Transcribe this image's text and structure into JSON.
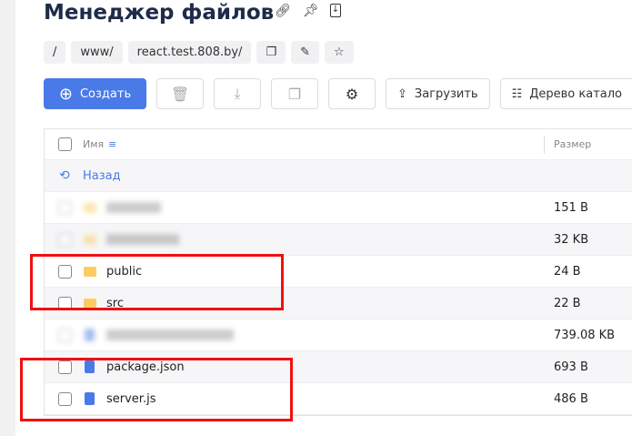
{
  "header": {
    "title": "Менеджер файлов",
    "icons": [
      "link-icon",
      "pin-icon",
      "download-file-icon"
    ]
  },
  "breadcrumbs": [
    "/",
    "www/",
    "react.test.808.by/"
  ],
  "breadcrumb_actions": [
    "copy-icon",
    "pencil-icon",
    "folder-star-icon"
  ],
  "toolbar": {
    "create_label": "Создать",
    "upload_label": "Загрузить",
    "tree_label": "Дерево катало"
  },
  "table": {
    "col_name": "Имя",
    "col_size": "Размер",
    "back_label": "Назад",
    "rows": [
      {
        "name": "",
        "type": "folder",
        "size": "151 B",
        "blurred": true
      },
      {
        "name": "",
        "type": "folder",
        "size": "32 KB",
        "blurred": true
      },
      {
        "name": "public",
        "type": "folder",
        "size": "24 B"
      },
      {
        "name": "src",
        "type": "folder",
        "size": "22 B"
      },
      {
        "name": "",
        "type": "file",
        "size": "739.08 KB",
        "blurred": true
      },
      {
        "name": "package.json",
        "type": "file",
        "size": "693 B"
      },
      {
        "name": "server.js",
        "type": "file",
        "size": "486 B"
      }
    ]
  },
  "colors": {
    "accent": "#4a7ae8",
    "highlight": "#f01010",
    "folder": "#fccc63"
  }
}
